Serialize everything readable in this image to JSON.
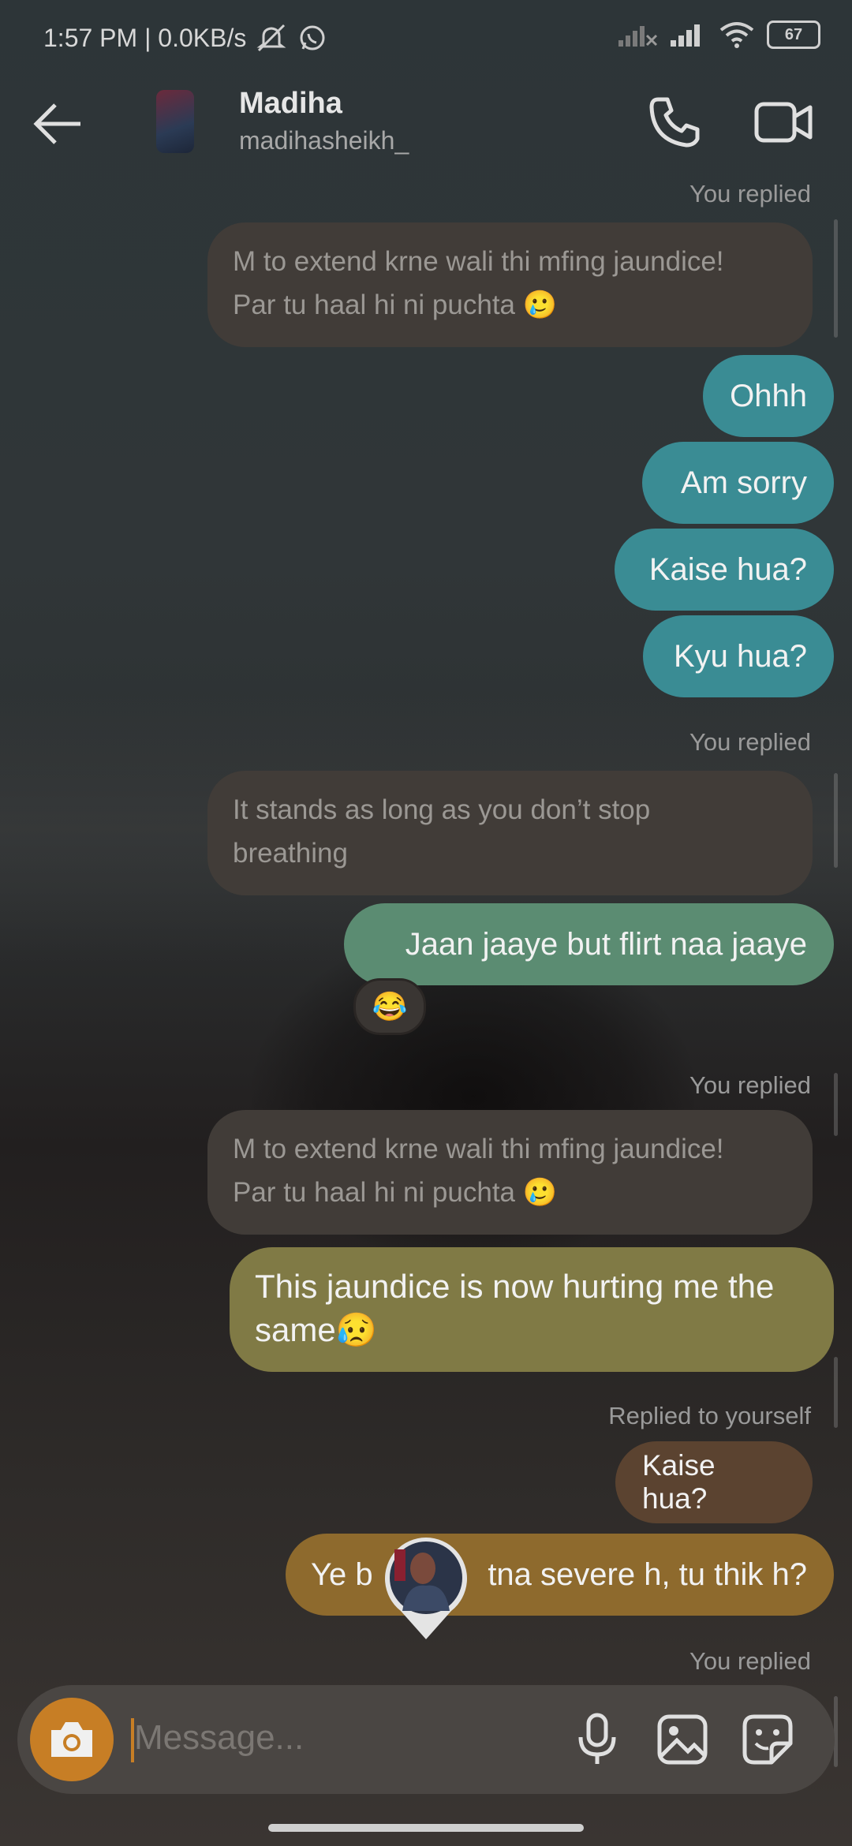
{
  "status_bar": {
    "time_text": "1:57 PM | 0.0KB/s",
    "battery": "67"
  },
  "header": {
    "name": "Madiha",
    "username": "madihasheikh_"
  },
  "messages": [
    {
      "label": "You replied",
      "reply": "M to extend krne wali thi mfing jaundice!\nPar tu haal hi ni puchta 🥲"
    },
    {
      "sent": "Ohhh"
    },
    {
      "sent": "Am sorry"
    },
    {
      "sent": "Kaise hua?"
    },
    {
      "sent": "Kyu hua?"
    },
    {
      "label": "You replied",
      "reply": "It stands as long as you don’t stop\nbreathing"
    },
    {
      "sent": "Jaan jaaye but flirt naa jaaye",
      "reaction": "😂"
    },
    {
      "label": "You replied",
      "reply": "M to extend krne wali thi mfing jaundice!\nPar tu haal hi ni puchta 🥲"
    },
    {
      "sent": "This jaundice is now hurting me the\nsame😥"
    },
    {
      "label": "Replied to yourself",
      "reply": "Kaise hua?"
    },
    {
      "sent": "Ye bas itna severe h, tu thik h?",
      "visible_left": "Ye b",
      "visible_right": "tna severe h, tu thik h?"
    },
    {
      "label": "You replied"
    }
  ],
  "composer": {
    "placeholder": "Message..."
  },
  "colors": {
    "teal": "#3a8c94",
    "sage": "#5b8c72",
    "olive": "#807a45",
    "amber": "#8e6a2d",
    "accent": "#c77e25",
    "reply_bubble": "#413c38"
  },
  "icons": [
    "back-arrow-icon",
    "phone-icon",
    "video-call-icon",
    "camera-icon",
    "microphone-icon",
    "gallery-icon",
    "sticker-icon",
    "mute-icon",
    "whatsapp-icon",
    "signal-icon",
    "wifi-icon",
    "battery-icon"
  ]
}
